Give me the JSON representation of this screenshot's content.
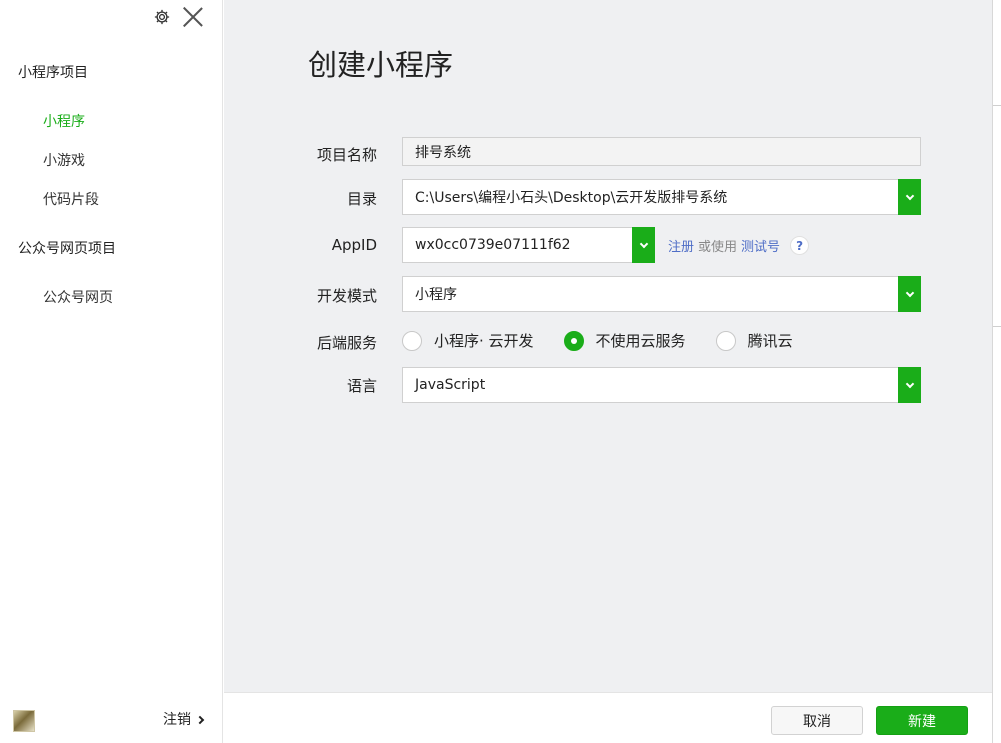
{
  "sidebar": {
    "groups": [
      {
        "label": "小程序项目",
        "items": [
          "小程序",
          "小游戏",
          "代码片段"
        ]
      },
      {
        "label": "公众号网页项目",
        "items": [
          "公众号网页"
        ]
      }
    ],
    "active_item": "小程序",
    "logout_label": "注销"
  },
  "main": {
    "title": "创建小程序",
    "fields": {
      "project_name": {
        "label": "项目名称",
        "value": "排号系统"
      },
      "directory": {
        "label": "目录",
        "value": "C:\\Users\\编程小石头\\Desktop\\云开发版排号系统"
      },
      "appid": {
        "label": "AppID",
        "value": "wx0cc0739e07111f62"
      },
      "dev_mode": {
        "label": "开发模式",
        "value": "小程序"
      },
      "backend": {
        "label": "后端服务",
        "options": [
          "小程序· 云开发",
          "不使用云服务",
          "腾讯云"
        ],
        "selected": "不使用云服务"
      },
      "language": {
        "label": "语言",
        "value": "JavaScript"
      }
    },
    "appid_links": {
      "register": "注册",
      "or_use": "或使用",
      "test_account": "测试号",
      "help": "?"
    }
  },
  "footer": {
    "cancel_label": "取消",
    "create_label": "新建"
  },
  "colors": {
    "accent": "#1aad19",
    "link": "#4f6ec7",
    "main_bg": "#eff0f2"
  }
}
